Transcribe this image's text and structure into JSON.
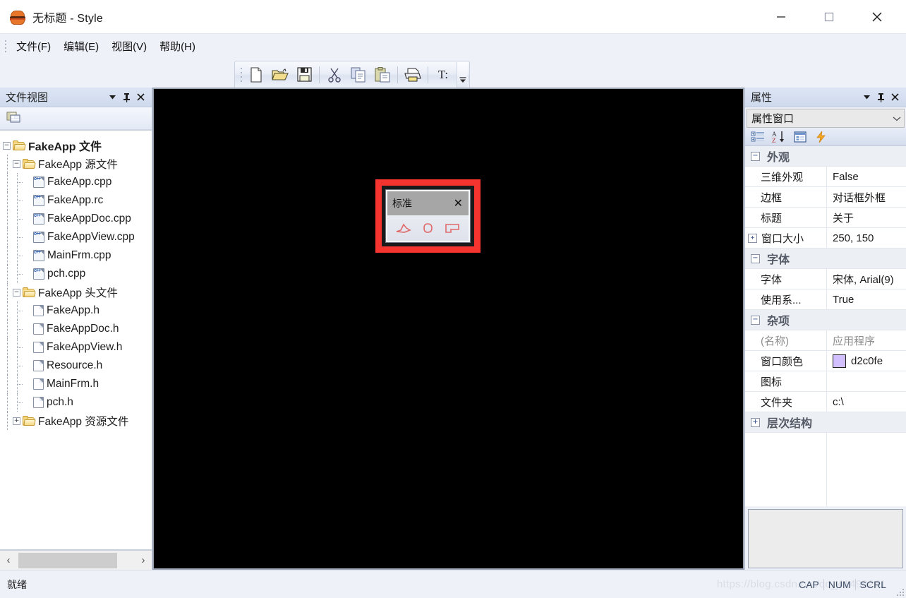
{
  "window": {
    "title": "无标题 - Style",
    "icon": "burger-icon",
    "minimize_label": "最小化",
    "maximize_label": "最大化",
    "close_label": "关闭"
  },
  "menubar": {
    "items": [
      {
        "label": "文件(F)",
        "name": "menu-file"
      },
      {
        "label": "编辑(E)",
        "name": "menu-edit"
      },
      {
        "label": "视图(V)",
        "name": "menu-view"
      },
      {
        "label": "帮助(H)",
        "name": "menu-help"
      }
    ]
  },
  "toolbar": {
    "buttons": [
      {
        "icon": "new-file-icon",
        "label": "新建"
      },
      {
        "icon": "open-folder-icon",
        "label": "打开"
      },
      {
        "icon": "save-icon",
        "label": "保存"
      },
      {
        "icon": "cut-scissors-icon",
        "label": "剪切"
      },
      {
        "icon": "copy-icon",
        "label": "复制"
      },
      {
        "icon": "paste-icon",
        "label": "粘贴"
      },
      {
        "icon": "print-icon",
        "label": "打印"
      }
    ],
    "text_tool_label": "T:",
    "overflow_icon": "chevron-down-icon"
  },
  "file_view": {
    "title": "文件视图",
    "header_icons": [
      "chevron-down-icon",
      "pin-icon",
      "close-icon"
    ],
    "toolbar_icon": "show-all-files-icon",
    "tree": [
      {
        "depth": 0,
        "label": "FakeApp 文件",
        "icon": "folder-icon",
        "state": "expanded",
        "bold": true
      },
      {
        "depth": 1,
        "label": "FakeApp 源文件",
        "icon": "folder-icon",
        "state": "expanded",
        "bold": false
      },
      {
        "depth": 2,
        "label": "FakeApp.cpp",
        "icon": "cpp-file-icon",
        "state": "leaf",
        "bold": false
      },
      {
        "depth": 2,
        "label": "FakeApp.rc",
        "icon": "cpp-file-icon",
        "state": "leaf",
        "bold": false
      },
      {
        "depth": 2,
        "label": "FakeAppDoc.cpp",
        "icon": "cpp-file-icon",
        "state": "leaf",
        "bold": false
      },
      {
        "depth": 2,
        "label": "FakeAppView.cpp",
        "icon": "cpp-file-icon",
        "state": "leaf",
        "bold": false
      },
      {
        "depth": 2,
        "label": "MainFrm.cpp",
        "icon": "cpp-file-icon",
        "state": "leaf",
        "bold": false
      },
      {
        "depth": 2,
        "label": "pch.cpp",
        "icon": "cpp-file-icon",
        "state": "leaf",
        "bold": false
      },
      {
        "depth": 1,
        "label": "FakeApp 头文件",
        "icon": "folder-icon",
        "state": "expanded",
        "bold": false
      },
      {
        "depth": 2,
        "label": "FakeApp.h",
        "icon": "header-file-icon",
        "state": "leaf",
        "bold": false
      },
      {
        "depth": 2,
        "label": "FakeAppDoc.h",
        "icon": "header-file-icon",
        "state": "leaf",
        "bold": false
      },
      {
        "depth": 2,
        "label": "FakeAppView.h",
        "icon": "header-file-icon",
        "state": "leaf",
        "bold": false
      },
      {
        "depth": 2,
        "label": "Resource.h",
        "icon": "header-file-icon",
        "state": "leaf",
        "bold": false
      },
      {
        "depth": 2,
        "label": "MainFrm.h",
        "icon": "header-file-icon",
        "state": "leaf",
        "bold": false
      },
      {
        "depth": 2,
        "label": "pch.h",
        "icon": "header-file-icon",
        "state": "leaf",
        "bold": false
      },
      {
        "depth": 1,
        "label": "FakeApp 资源文件",
        "icon": "folder-icon",
        "state": "collapsed",
        "bold": false
      }
    ],
    "scrollbar": {
      "left_arrow": "‹",
      "right_arrow": "›"
    }
  },
  "canvas": {
    "background_color": "#000000",
    "dialog": {
      "selection_color": "#f5332f",
      "title": "标准",
      "close_label": "✕",
      "tools": [
        "polygon-shape-icon",
        "blob-shape-icon",
        "flag-shape-icon"
      ],
      "tool_color": "#e87b7b"
    }
  },
  "properties": {
    "title": "属性",
    "header_icons": [
      "chevron-down-icon",
      "pin-icon",
      "close-icon"
    ],
    "selector_value": "属性窗口",
    "toolbar_icons": [
      "categorized-icon",
      "alphabetical-sort-icon",
      "property-pages-icon",
      "events-lightning-icon"
    ],
    "groups": [
      {
        "name": "外观",
        "state": "expanded",
        "rows": [
          {
            "key": "三维外观",
            "value": "False",
            "type": "text"
          },
          {
            "key": "边框",
            "value": "对话框外框",
            "type": "text"
          },
          {
            "key": "标题",
            "value": "关于",
            "type": "text"
          },
          {
            "key": "窗口大小",
            "value": "250, 150",
            "type": "expandable"
          }
        ]
      },
      {
        "name": "字体",
        "state": "expanded",
        "rows": [
          {
            "key": "字体",
            "value": "宋体, Arial(9)",
            "type": "text"
          },
          {
            "key": "使用系...",
            "value": "True",
            "type": "text"
          }
        ]
      },
      {
        "name": "杂项",
        "state": "expanded",
        "rows": [
          {
            "key": "(名称)",
            "value": "应用程序",
            "type": "dim"
          },
          {
            "key": "窗口颜色",
            "value": "d2c0fe",
            "type": "color",
            "color": "#d2c0fe"
          },
          {
            "key": "图标",
            "value": "",
            "type": "text"
          },
          {
            "key": "文件夹",
            "value": "c:\\",
            "type": "text"
          }
        ]
      },
      {
        "name": "层次结构",
        "state": "collapsed",
        "rows": []
      }
    ]
  },
  "statusbar": {
    "message": "就绪",
    "watermark": "https://blog.csdn.net/qq_41499261",
    "indicators": [
      "CAP",
      "NUM",
      "SCRL"
    ]
  }
}
